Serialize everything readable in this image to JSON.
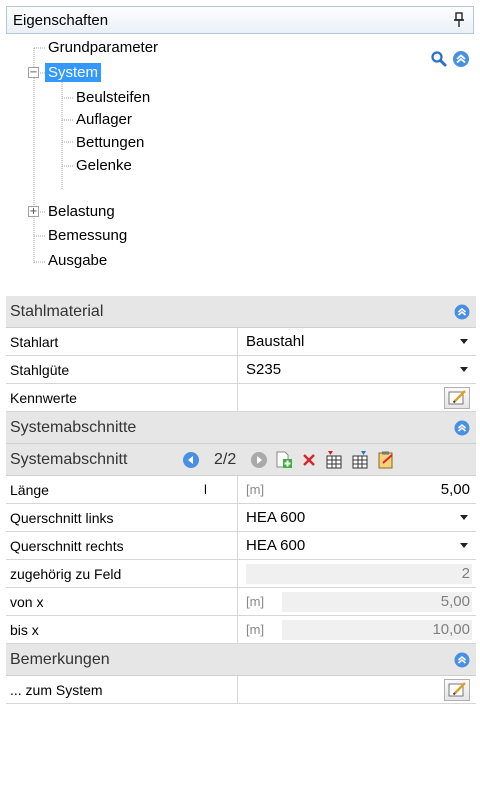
{
  "panel": {
    "title": "Eigenschaften"
  },
  "tree": {
    "items": [
      {
        "label": "Grundparameter"
      },
      {
        "label": "System"
      },
      {
        "label": "Beulsteifen"
      },
      {
        "label": "Auflager"
      },
      {
        "label": "Bettungen"
      },
      {
        "label": "Gelenke"
      },
      {
        "label": "Belastung"
      },
      {
        "label": "Bemessung"
      },
      {
        "label": "Ausgabe"
      }
    ],
    "expander_open": "−",
    "expander_closed": "+"
  },
  "sections": {
    "stahlmaterial": {
      "title": "Stahlmaterial",
      "rows": [
        {
          "label": "Stahlart",
          "value": "Baustahl"
        },
        {
          "label": "Stahlgüte",
          "value": "S235"
        },
        {
          "label": "Kennwerte",
          "value": ""
        }
      ]
    },
    "systemabschnitte": {
      "title": "Systemabschnitte",
      "nav_title": "Systemabschnitt",
      "nav_count": "2/2",
      "rows": [
        {
          "label": "Länge",
          "marker": "l",
          "unit": "[m]",
          "value": "5,00"
        },
        {
          "label": "Querschnitt links",
          "value": "HEA 600"
        },
        {
          "label": "Querschnitt rechts",
          "value": "HEA 600"
        },
        {
          "label": "zugehörig zu Feld",
          "value": "2"
        },
        {
          "label": "von x",
          "unit": "[m]",
          "value": "5,00"
        },
        {
          "label": "bis x",
          "unit": "[m]",
          "value": "10,00"
        }
      ]
    },
    "bemerkungen": {
      "title": "Bemerkungen",
      "rows": [
        {
          "label": "... zum System",
          "value": ""
        }
      ]
    }
  },
  "colors": {
    "selection": "#3399ff",
    "section_bg": "#e6e6e6",
    "collapse_icon": "#4a90e2",
    "add_icon": "#3cb043",
    "delete_icon": "#d9232d"
  }
}
